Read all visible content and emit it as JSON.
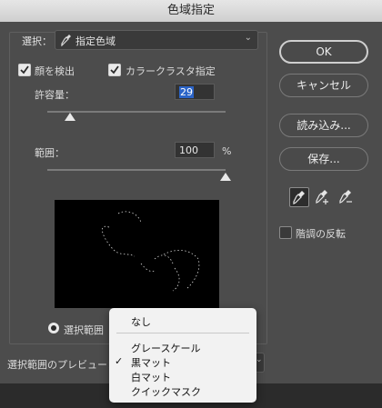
{
  "window": {
    "title": "色域指定"
  },
  "select": {
    "label": "選択：",
    "value": "指定色域"
  },
  "options": {
    "face_detect": {
      "label": "顔を検出",
      "checked": true
    },
    "color_cluster": {
      "label": "カラークラスタ指定",
      "checked": true
    }
  },
  "tolerance": {
    "label": "許容量：",
    "value": "29",
    "slider_fraction": 0.22
  },
  "range": {
    "label": "範囲：",
    "value": "100",
    "unit": "%",
    "slider_fraction": 1.0
  },
  "buttons": {
    "ok": "OK",
    "cancel": "キャンセル",
    "load": "読み込み...",
    "save": "保存..."
  },
  "eyedroppers": [
    "eyedropper-icon",
    "eyedropper-add-icon",
    "eyedropper-subtract-icon"
  ],
  "invert": {
    "label": "階調の反転",
    "checked": false
  },
  "view": {
    "selection_label": "選択範囲"
  },
  "preview_label": "選択範囲のプレビュー：",
  "preview_menu": {
    "items": [
      "なし",
      "グレースケール",
      "黒マット",
      "白マット",
      "クイックマスク"
    ],
    "selected": "黒マット"
  },
  "colors": {
    "accent": "#2b64c8",
    "dialog_bg": "#4c4c4c"
  }
}
